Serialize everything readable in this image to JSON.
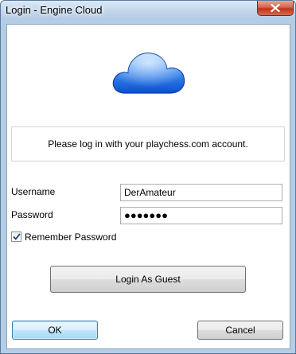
{
  "window": {
    "title": "Login - Engine Cloud"
  },
  "icons": {
    "cloud": "cloud-icon",
    "close": "close-icon",
    "check": "checkmark-icon"
  },
  "info": {
    "message": "Please log in with your playchess.com account."
  },
  "form": {
    "username_label": "Username",
    "username_value": "DerAmateur",
    "password_label": "Password",
    "password_mask": "●●●●●●●",
    "remember_label": "Remember Password",
    "remember_checked": true
  },
  "buttons": {
    "guest": "Login As Guest",
    "ok": "OK",
    "cancel": "Cancel"
  },
  "colors": {
    "cloud_blue": "#2f7fe6",
    "accent": "#3c7fb1",
    "close_red": "#c0331b"
  }
}
